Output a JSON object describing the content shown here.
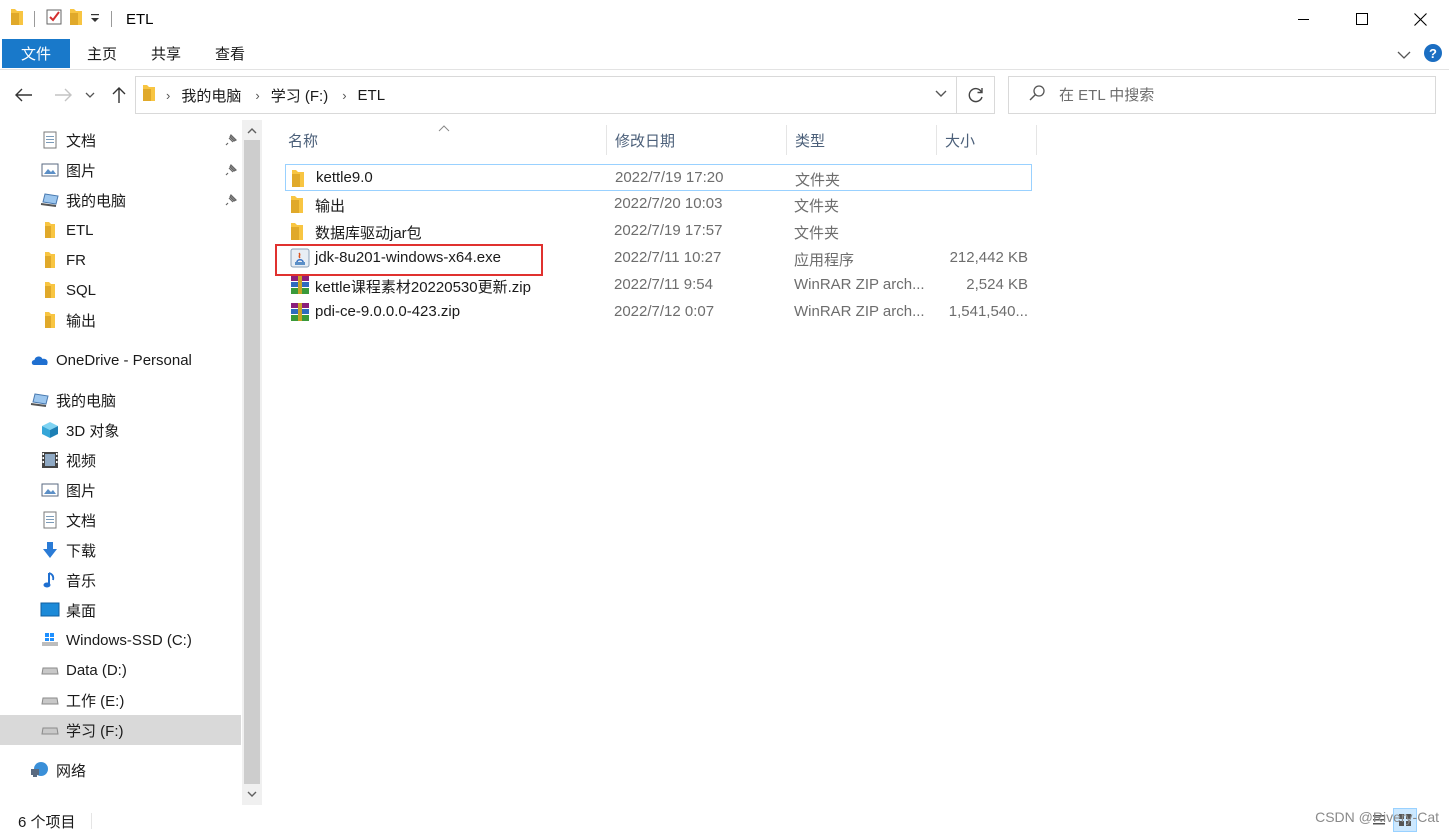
{
  "window": {
    "title": "ETL"
  },
  "ribbon": {
    "tabs": [
      {
        "label": "文件",
        "active": true
      },
      {
        "label": "主页",
        "active": false
      },
      {
        "label": "共享",
        "active": false
      },
      {
        "label": "查看",
        "active": false
      }
    ]
  },
  "address": {
    "crumbs": [
      "我的电脑",
      "学习 (F:)",
      "ETL"
    ]
  },
  "search": {
    "placeholder": "在 ETL 中搜索"
  },
  "sidebar": {
    "items": [
      {
        "label": "文档",
        "icon": "document-icon",
        "pinned": true
      },
      {
        "label": "图片",
        "icon": "picture-icon",
        "pinned": true
      },
      {
        "label": "我的电脑",
        "icon": "computer-icon",
        "pinned": true
      },
      {
        "label": "ETL",
        "icon": "folder-icon",
        "pinned": false
      },
      {
        "label": "FR",
        "icon": "folder-icon",
        "pinned": false
      },
      {
        "label": "SQL",
        "icon": "folder-icon",
        "pinned": false
      },
      {
        "label": "输出",
        "icon": "folder-icon",
        "pinned": false
      },
      {
        "label": "OneDrive - Personal",
        "icon": "onedrive-icon",
        "pinned": false
      },
      {
        "label": "我的电脑",
        "icon": "computer-icon",
        "pinned": false
      },
      {
        "label": "3D 对象",
        "icon": "3d-objects-icon",
        "pinned": false
      },
      {
        "label": "视频",
        "icon": "video-icon",
        "pinned": false
      },
      {
        "label": "图片",
        "icon": "picture-icon",
        "pinned": false
      },
      {
        "label": "文档",
        "icon": "document-icon",
        "pinned": false
      },
      {
        "label": "下载",
        "icon": "download-icon",
        "pinned": false
      },
      {
        "label": "音乐",
        "icon": "music-icon",
        "pinned": false
      },
      {
        "label": "桌面",
        "icon": "desktop-icon",
        "pinned": false
      },
      {
        "label": "Windows-SSD (C:)",
        "icon": "windows-drive-icon",
        "pinned": false
      },
      {
        "label": "Data (D:)",
        "icon": "drive-icon",
        "pinned": false
      },
      {
        "label": "工作 (E:)",
        "icon": "drive-icon",
        "pinned": false
      },
      {
        "label": "学习 (F:)",
        "icon": "drive-icon",
        "pinned": false,
        "selected": true
      },
      {
        "label": "网络",
        "icon": "network-icon",
        "pinned": false
      }
    ]
  },
  "columns": {
    "name": "名称",
    "date": "修改日期",
    "type": "类型",
    "size": "大小"
  },
  "files": [
    {
      "name": "kettle9.0",
      "date": "2022/7/19 17:20",
      "type": "文件夹",
      "size": "",
      "icon": "folder-icon"
    },
    {
      "name": "输出",
      "date": "2022/7/20 10:03",
      "type": "文件夹",
      "size": "",
      "icon": "folder-icon"
    },
    {
      "name": "数据库驱动jar包",
      "date": "2022/7/19 17:57",
      "type": "文件夹",
      "size": "",
      "icon": "folder-icon"
    },
    {
      "name": "jdk-8u201-windows-x64.exe",
      "date": "2022/7/11 10:27",
      "type": "应用程序",
      "size": "212,442 KB",
      "icon": "java-installer-icon"
    },
    {
      "name": "kettle课程素材20220530更新.zip",
      "date": "2022/7/11 9:54",
      "type": "WinRAR ZIP arch...",
      "size": "2,524 KB",
      "icon": "winrar-archive-icon"
    },
    {
      "name": "pdi-ce-9.0.0.0-423.zip",
      "date": "2022/7/12 0:07",
      "type": "WinRAR ZIP arch...",
      "size": "1,541,540...",
      "icon": "winrar-archive-icon"
    }
  ],
  "status": {
    "item_count": "6 个项目",
    "watermark": "CSDN @Rivery-Cat"
  },
  "colors": {
    "accent": "#1979ca",
    "highlight_border": "#e0312f",
    "folder_yellow": "#f8c542"
  }
}
